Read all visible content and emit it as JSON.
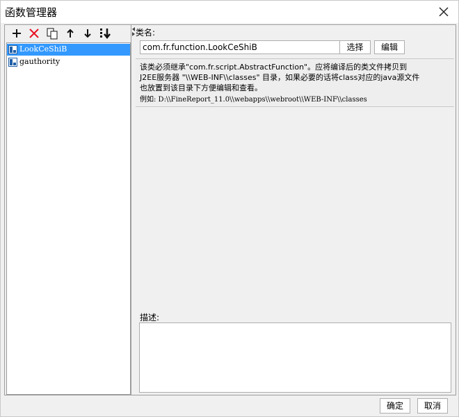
{
  "window": {
    "title": "函数管理器"
  },
  "toolbar": {
    "add": "add-icon",
    "delete": "delete-icon",
    "copy": "copy-icon",
    "up": "arrow-up-icon",
    "down": "arrow-down-icon",
    "sort": "sort-icon"
  },
  "tree": {
    "items": [
      {
        "label": "LookCeShiB",
        "selected": true
      },
      {
        "label": "gauthority",
        "selected": false
      }
    ]
  },
  "form": {
    "classname_label": "类名:",
    "classname_value": "com.fr.function.LookCeShiB",
    "select_label": "选择",
    "edit_label": "编辑",
    "info_line1": "该类必须继承\"com.fr.script.AbstractFunction\"。应将编译后的类文件拷贝到",
    "info_line2": "J2EE服务器 \"\\\\WEB-INF\\\\classes\" 目录，如果必要的话将class对应的java源文件",
    "info_line3": "也放置到该目录下方便编辑和查看。",
    "info_line4": "例如: D:\\\\FineReport_11.0\\\\webapps\\\\webroot\\\\WEB-INF\\\\classes",
    "desc_label": "描述:",
    "desc_value": ""
  },
  "footer": {
    "ok_label": "确定",
    "cancel_label": "取消"
  },
  "colors": {
    "selection": "#3399ff",
    "delete": "#e81123"
  }
}
